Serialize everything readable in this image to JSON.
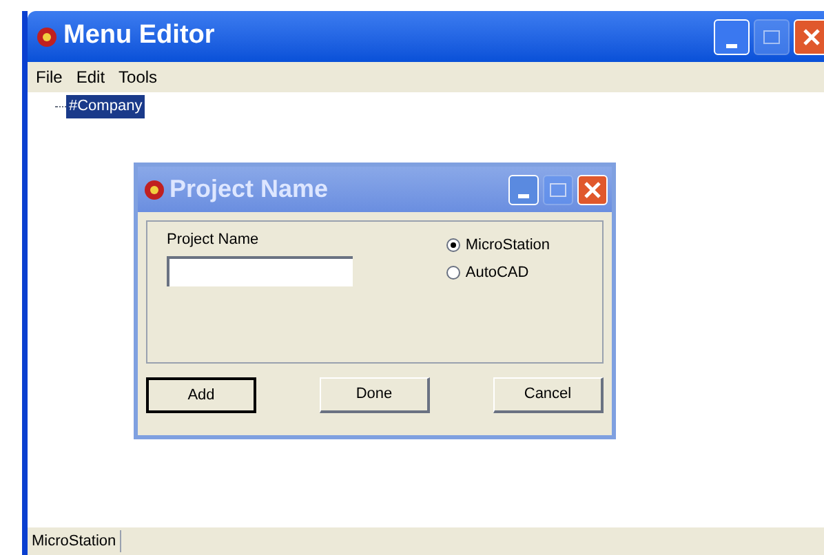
{
  "window": {
    "title": "Menu Editor"
  },
  "menu": [
    "File",
    "Edit",
    "Tools"
  ],
  "tree": [
    {
      "label": "#Company",
      "selected": true
    }
  ],
  "dialog": {
    "title": "Project Name",
    "field": {
      "label": "Project Name"
    },
    "radios": [
      {
        "label": "MicroStation",
        "selected": true
      },
      {
        "label": "AutoCAD",
        "selected": false
      }
    ],
    "buttons": [
      {
        "label": "Add",
        "default": true
      },
      {
        "label": "Done",
        "default": false
      },
      {
        "label": "Cancel",
        "default": false
      }
    ]
  },
  "status_bar": [
    "MicroStation"
  ]
}
